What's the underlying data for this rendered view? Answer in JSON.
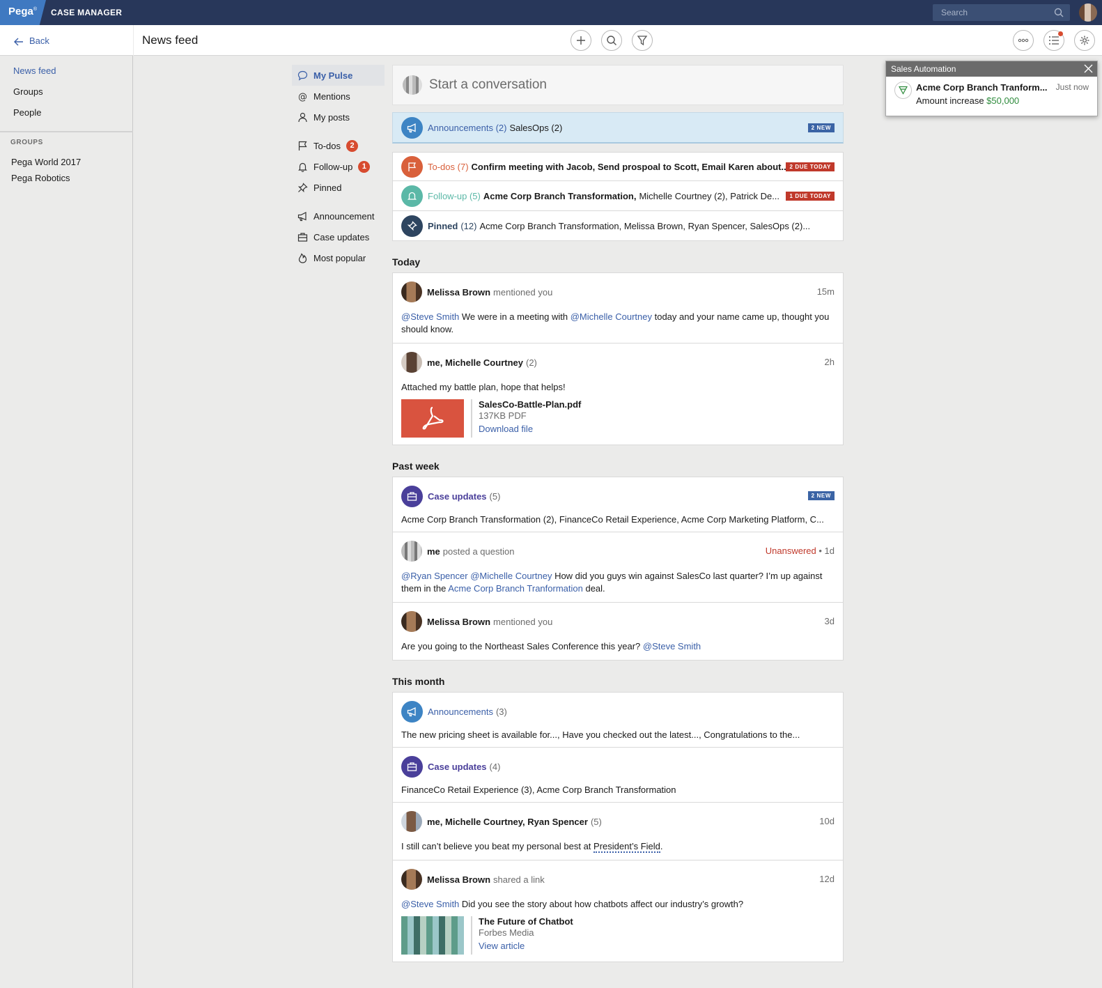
{
  "topbar": {
    "logo": "Pega",
    "logo_mark": "®",
    "app_name": "CASE MANAGER",
    "search_placeholder": "Search"
  },
  "sidebar": {
    "back_label": "Back",
    "items": [
      {
        "label": "News feed"
      },
      {
        "label": "Groups"
      },
      {
        "label": "People"
      }
    ],
    "groups_heading": "GROUPS",
    "groups": [
      "Pega World 2017",
      "Pega Robotics"
    ]
  },
  "header": {
    "title": "News feed"
  },
  "filters": {
    "my_pulse": "My Pulse",
    "mentions": "Mentions",
    "my_posts": "My posts",
    "todos": "To-dos",
    "todos_count": "2",
    "followup": "Follow-up",
    "followup_count": "1",
    "pinned": "Pinned",
    "announcement": "Announcement",
    "case_updates": "Case updates",
    "most_popular": "Most popular"
  },
  "composer": {
    "placeholder": "Start a conversation"
  },
  "summary": {
    "announcements": {
      "label": "Announcements (2)",
      "detail": "SalesOps (2)",
      "tag": "2 NEW"
    },
    "todos": {
      "label": "To-dos (7)",
      "detail": "Confirm meeting with Jacob, Send prospoal to Scott, Email Karen about...",
      "tag": "2 DUE TODAY"
    },
    "followup": {
      "label": "Follow-up (5)",
      "detail_bold": "Acme Corp Branch Transformation,",
      "detail": "Michelle Courtney (2), Patrick De...",
      "tag": "1 DUE TODAY"
    },
    "pinned": {
      "label": "Pinned",
      "count": "(12)",
      "detail": "Acme Corp Branch Transformation, Melissa Brown, Ryan Spencer, SalesOps (2)..."
    }
  },
  "sections": {
    "today": "Today",
    "past_week": "Past week",
    "this_month": "This month"
  },
  "today": {
    "p1": {
      "name": "Melissa Brown",
      "verb": "mentioned you",
      "time": "15m",
      "m1": "@Steve Smith",
      "t1": " We were in a meeting with ",
      "m2": "@Michelle Courtney",
      "t2": " today and your name came up, thought you should know."
    },
    "p2": {
      "name": "me, Michelle Courtney",
      "count": "(2)",
      "time": "2h",
      "body": "Attached my battle plan, hope that helps!",
      "file_name": "SalesCo-Battle-Plan.pdf",
      "file_size": "137KB PDF",
      "file_action": "Download file"
    }
  },
  "past_week": {
    "case": {
      "label": "Case updates",
      "count": "(5)",
      "tag": "2 NEW",
      "body": "Acme Corp Branch Transformation (2), FinanceCo Retail Experience, Acme Corp Marketing Platform, C..."
    },
    "q": {
      "name": "me",
      "verb": "posted a question",
      "status": "Unanswered",
      "time": " • 1d",
      "m1": "@Ryan Spencer",
      "m2": "@Michelle Courtney",
      "t1": " How did you guys win against SalesCo last quarter? I’m up against them in the ",
      "m3": "Acme Corp Branch Tranformation",
      "t2": " deal."
    },
    "p3": {
      "name": "Melissa Brown",
      "verb": "mentioned you",
      "time": "3d",
      "t1": "Are you going to the Northeast Sales Conference this year? ",
      "m1": "@Steve Smith"
    }
  },
  "this_month": {
    "ann": {
      "label": "Announcements",
      "count": "(3)",
      "body": "The new pricing sheet is available for..., Have you checked out the latest..., Congratulations to the..."
    },
    "case": {
      "label": "Case updates",
      "count": "(4)",
      "body": "FinanceCo Retail Experience (3), Acme Corp Branch Transformation"
    },
    "p4": {
      "name": "me, Michelle Courtney, Ryan Spencer",
      "count": "(5)",
      "time": "10d",
      "t1": "I still can’t believe you beat my personal best at ",
      "link": "President’s Field",
      "t2": "."
    },
    "p5": {
      "name": "Melissa Brown",
      "verb": "shared a link",
      "time": "12d",
      "m1": "@Steve Smith",
      "t1": " Did you see the story about how chatbots affect our industry’s growth?",
      "link_title": "The Future of Chatbot",
      "link_source": "Forbes Media",
      "link_action": "View article"
    }
  },
  "toast": {
    "title": "Sales Automation",
    "case": "Acme Corp Branch Tranform...",
    "time": "Just now",
    "text": "Amount increase ",
    "amount": "$50,000"
  },
  "colors": {
    "topbar": "#28375a",
    "logo": "#3f79c1",
    "link": "#3a5fa8",
    "todo": "#d9603b",
    "followup": "#5bb8a7",
    "pinned": "#2e4560",
    "case": "#4a3f9a",
    "announce": "#3d84c4",
    "alert": "#c0392b",
    "amount": "#2e8b3c"
  }
}
